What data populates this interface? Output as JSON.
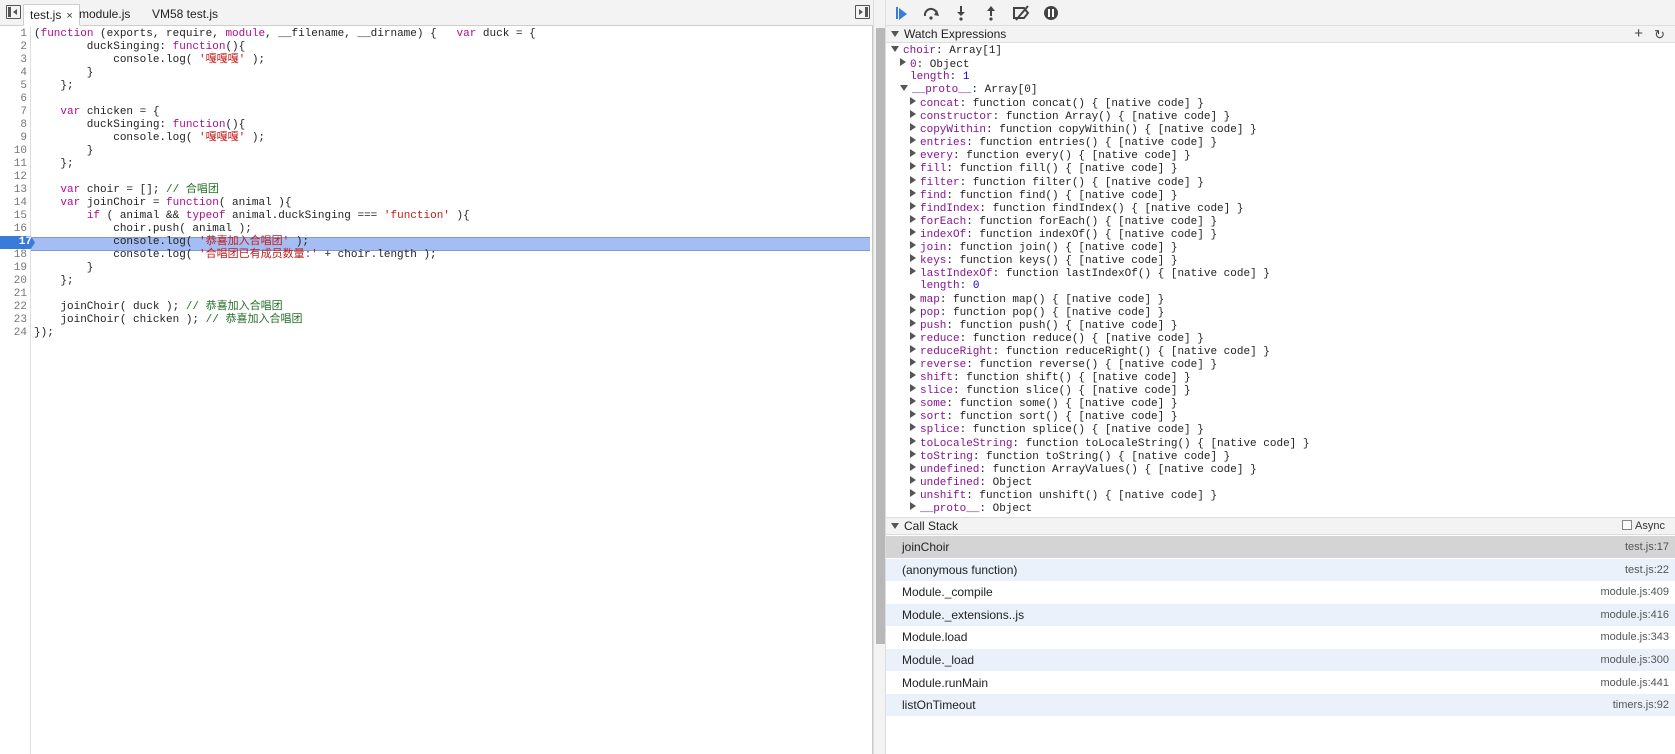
{
  "file_tabs": [
    {
      "label": "test.js",
      "close": "×"
    },
    {
      "label": "module.js"
    },
    {
      "label": "VM58 test.js"
    }
  ],
  "editor": {
    "current_line": 17,
    "line_numbers": [
      "1",
      "2",
      "3",
      "4",
      "5",
      "6",
      "7",
      "8",
      "9",
      "10",
      "11",
      "12",
      "13",
      "14",
      "15",
      "16",
      "17",
      "18",
      "19",
      "20",
      "21",
      "22",
      "23",
      "24"
    ],
    "lines": [
      [
        {
          "t": "(",
          "c": ""
        },
        {
          "t": "function",
          "c": "kw"
        },
        {
          "t": " (exports, require, ",
          "c": ""
        },
        {
          "t": "module",
          "c": "kw"
        },
        {
          "t": ", __filename, __dirname) {   ",
          "c": ""
        },
        {
          "t": "var",
          "c": "kw"
        },
        {
          "t": " duck = {",
          "c": ""
        }
      ],
      [
        {
          "t": "        duckSinging: ",
          "c": ""
        },
        {
          "t": "function",
          "c": "kw"
        },
        {
          "t": "(){",
          "c": ""
        }
      ],
      [
        {
          "t": "            console.log( ",
          "c": ""
        },
        {
          "t": "'嘎嘎嘎'",
          "c": "st"
        },
        {
          "t": " );",
          "c": ""
        }
      ],
      [
        {
          "t": "        }",
          "c": ""
        }
      ],
      [
        {
          "t": "    };",
          "c": ""
        }
      ],
      [
        {
          "t": "",
          "c": ""
        }
      ],
      [
        {
          "t": "    ",
          "c": ""
        },
        {
          "t": "var",
          "c": "kw"
        },
        {
          "t": " chicken = {",
          "c": ""
        }
      ],
      [
        {
          "t": "        duckSinging: ",
          "c": ""
        },
        {
          "t": "function",
          "c": "kw"
        },
        {
          "t": "(){",
          "c": ""
        }
      ],
      [
        {
          "t": "            console.log( ",
          "c": ""
        },
        {
          "t": "'嘎嘎嘎'",
          "c": "st"
        },
        {
          "t": " );",
          "c": ""
        }
      ],
      [
        {
          "t": "        }",
          "c": ""
        }
      ],
      [
        {
          "t": "    };",
          "c": ""
        }
      ],
      [
        {
          "t": "",
          "c": ""
        }
      ],
      [
        {
          "t": "    ",
          "c": ""
        },
        {
          "t": "var",
          "c": "kw"
        },
        {
          "t": " choir = []; ",
          "c": ""
        },
        {
          "t": "// 合唱团",
          "c": "cm"
        }
      ],
      [
        {
          "t": "    ",
          "c": ""
        },
        {
          "t": "var",
          "c": "kw"
        },
        {
          "t": " joinChoir = ",
          "c": ""
        },
        {
          "t": "function",
          "c": "kw"
        },
        {
          "t": "( animal ){",
          "c": ""
        }
      ],
      [
        {
          "t": "        ",
          "c": ""
        },
        {
          "t": "if",
          "c": "kw"
        },
        {
          "t": " ( animal && ",
          "c": ""
        },
        {
          "t": "typeof",
          "c": "kw"
        },
        {
          "t": " animal.duckSinging === ",
          "c": ""
        },
        {
          "t": "'function'",
          "c": "st"
        },
        {
          "t": " ){",
          "c": ""
        }
      ],
      [
        {
          "t": "            choir.push( animal );",
          "c": ""
        }
      ],
      [
        {
          "t": "            console.log( ",
          "c": ""
        },
        {
          "t": "'恭喜加入合唱团'",
          "c": "st"
        },
        {
          "t": " );",
          "c": ""
        }
      ],
      [
        {
          "t": "            console.log( ",
          "c": ""
        },
        {
          "t": "'合唱团已有成员数量:'",
          "c": "st"
        },
        {
          "t": " + choir.length );",
          "c": ""
        }
      ],
      [
        {
          "t": "        }",
          "c": ""
        }
      ],
      [
        {
          "t": "    };",
          "c": ""
        }
      ],
      [
        {
          "t": "",
          "c": ""
        }
      ],
      [
        {
          "t": "    joinChoir( duck ); ",
          "c": ""
        },
        {
          "t": "// 恭喜加入合唱团",
          "c": "cm"
        }
      ],
      [
        {
          "t": "    joinChoir( chicken ); ",
          "c": ""
        },
        {
          "t": "// 恭喜加入合唱团",
          "c": "cm"
        }
      ],
      [
        {
          "t": "});",
          "c": ""
        }
      ]
    ]
  },
  "debugger_toolbar": {
    "icons": [
      "resume-icon",
      "step-over-icon",
      "step-into-icon",
      "step-out-icon",
      "deactivate-breakpoints-icon",
      "pause-on-exceptions-icon"
    ]
  },
  "watch": {
    "title": "Watch Expressions",
    "add": "+",
    "refresh": "C",
    "rows": [
      {
        "ind": 0,
        "tri": "d",
        "k": "choir",
        "v": ": Array[1]"
      },
      {
        "ind": 1,
        "tri": "r",
        "k": "0",
        "v": ": Object"
      },
      {
        "ind": 1,
        "tri": "",
        "k": "length",
        "v": ": ",
        "n": "1"
      },
      {
        "ind": 1,
        "tri": "d",
        "k": "__proto__",
        "v": ": Array[0]"
      },
      {
        "ind": 2,
        "tri": "r",
        "k": "concat",
        "v": ": function concat() { [native code] }"
      },
      {
        "ind": 2,
        "tri": "r",
        "k": "constructor",
        "v": ": function Array() { [native code] }"
      },
      {
        "ind": 2,
        "tri": "r",
        "k": "copyWithin",
        "v": ": function copyWithin() { [native code] }"
      },
      {
        "ind": 2,
        "tri": "r",
        "k": "entries",
        "v": ": function entries() { [native code] }"
      },
      {
        "ind": 2,
        "tri": "r",
        "k": "every",
        "v": ": function every() { [native code] }"
      },
      {
        "ind": 2,
        "tri": "r",
        "k": "fill",
        "v": ": function fill() { [native code] }"
      },
      {
        "ind": 2,
        "tri": "r",
        "k": "filter",
        "v": ": function filter() { [native code] }"
      },
      {
        "ind": 2,
        "tri": "r",
        "k": "find",
        "v": ": function find() { [native code] }"
      },
      {
        "ind": 2,
        "tri": "r",
        "k": "findIndex",
        "v": ": function findIndex() { [native code] }"
      },
      {
        "ind": 2,
        "tri": "r",
        "k": "forEach",
        "v": ": function forEach() { [native code] }"
      },
      {
        "ind": 2,
        "tri": "r",
        "k": "indexOf",
        "v": ": function indexOf() { [native code] }"
      },
      {
        "ind": 2,
        "tri": "r",
        "k": "join",
        "v": ": function join() { [native code] }"
      },
      {
        "ind": 2,
        "tri": "r",
        "k": "keys",
        "v": ": function keys() { [native code] }"
      },
      {
        "ind": 2,
        "tri": "r",
        "k": "lastIndexOf",
        "v": ": function lastIndexOf() { [native code] }"
      },
      {
        "ind": 2,
        "tri": "",
        "k": "length",
        "v": ": ",
        "n": "0"
      },
      {
        "ind": 2,
        "tri": "r",
        "k": "map",
        "v": ": function map() { [native code] }"
      },
      {
        "ind": 2,
        "tri": "r",
        "k": "pop",
        "v": ": function pop() { [native code] }"
      },
      {
        "ind": 2,
        "tri": "r",
        "k": "push",
        "v": ": function push() { [native code] }"
      },
      {
        "ind": 2,
        "tri": "r",
        "k": "reduce",
        "v": ": function reduce() { [native code] }"
      },
      {
        "ind": 2,
        "tri": "r",
        "k": "reduceRight",
        "v": ": function reduceRight() { [native code] }"
      },
      {
        "ind": 2,
        "tri": "r",
        "k": "reverse",
        "v": ": function reverse() { [native code] }"
      },
      {
        "ind": 2,
        "tri": "r",
        "k": "shift",
        "v": ": function shift() { [native code] }"
      },
      {
        "ind": 2,
        "tri": "r",
        "k": "slice",
        "v": ": function slice() { [native code] }"
      },
      {
        "ind": 2,
        "tri": "r",
        "k": "some",
        "v": ": function some() { [native code] }"
      },
      {
        "ind": 2,
        "tri": "r",
        "k": "sort",
        "v": ": function sort() { [native code] }"
      },
      {
        "ind": 2,
        "tri": "r",
        "k": "splice",
        "v": ": function splice() { [native code] }"
      },
      {
        "ind": 2,
        "tri": "r",
        "k": "toLocaleString",
        "v": ": function toLocaleString() { [native code] }"
      },
      {
        "ind": 2,
        "tri": "r",
        "k": "toString",
        "v": ": function toString() { [native code] }"
      },
      {
        "ind": 2,
        "tri": "r",
        "k": "undefined",
        "v": ": function ArrayValues() { [native code] }"
      },
      {
        "ind": 2,
        "tri": "r",
        "k": "undefined",
        "v": ": Object"
      },
      {
        "ind": 2,
        "tri": "r",
        "k": "unshift",
        "v": ": function unshift() { [native code] }"
      },
      {
        "ind": 2,
        "tri": "r",
        "k": "__proto__",
        "v": ": Object"
      }
    ]
  },
  "call_stack": {
    "title": "Call Stack",
    "async_label": "Async",
    "frames": [
      {
        "name": "joinChoir",
        "loc": "test.js:17",
        "selected": true
      },
      {
        "name": "(anonymous function)",
        "loc": "test.js:22"
      },
      {
        "name": "Module._compile",
        "loc": "module.js:409"
      },
      {
        "name": "Module._extensions..js",
        "loc": "module.js:416"
      },
      {
        "name": "Module.load",
        "loc": "module.js:343"
      },
      {
        "name": "Module._load",
        "loc": "module.js:300"
      },
      {
        "name": "Module.runMain",
        "loc": "module.js:441"
      },
      {
        "name": "listOnTimeout",
        "loc": "timers.js:92"
      }
    ]
  }
}
